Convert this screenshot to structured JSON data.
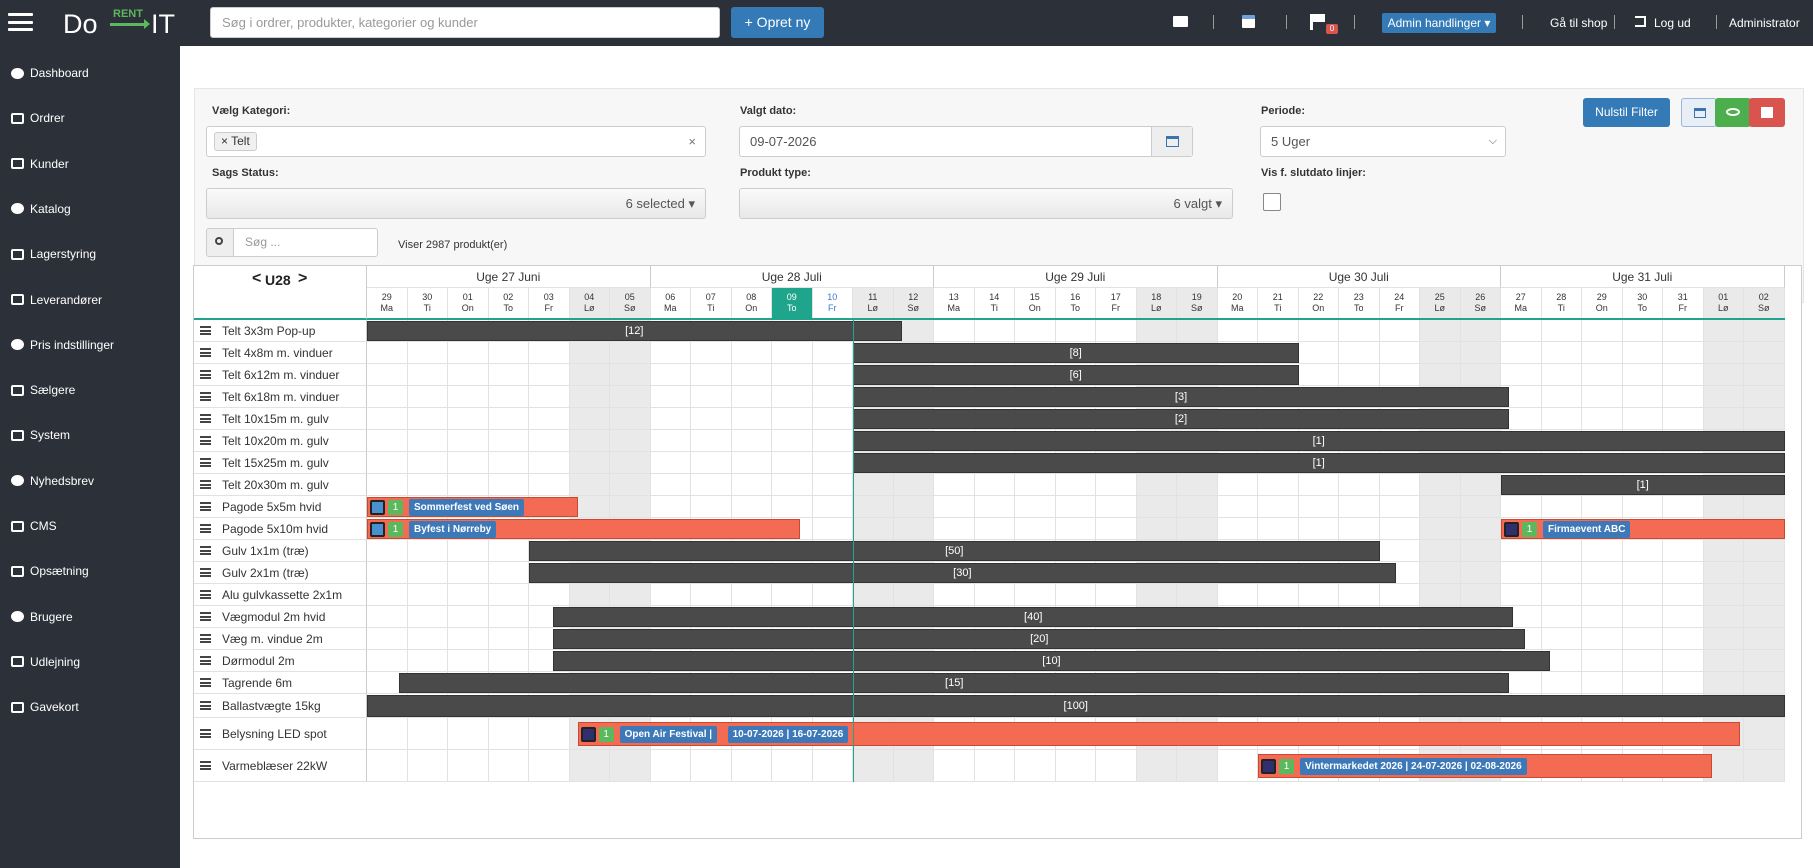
{
  "topbar": {
    "logo_left": "Do",
    "logo_middle": "RENT",
    "logo_right": "IT",
    "search_placeholder": "Søg i ordrer, produkter, kategorier og kunder",
    "new_button": "+ Opret ny",
    "flag_badge": "0",
    "admin_actions": "Admin handlinger ▾",
    "goto_shop": "Gå til shop",
    "logout": "Log ud",
    "user": "Administrator"
  },
  "sidebar": {
    "items": [
      {
        "label": "Dashboard",
        "icon": "dashboard-icon"
      },
      {
        "label": "Ordrer",
        "icon": "cart-icon"
      },
      {
        "label": "Kunder",
        "icon": "user-icon"
      },
      {
        "label": "Katalog",
        "icon": "folder-icon"
      },
      {
        "label": "Lagerstyring",
        "icon": "bar-chart-icon"
      },
      {
        "label": "Leverandører",
        "icon": "truck-icon"
      },
      {
        "label": "Pris indstillinger",
        "icon": "money-icon"
      },
      {
        "label": "Sælgere",
        "icon": "users-icon"
      },
      {
        "label": "System",
        "icon": "hdd-icon"
      },
      {
        "label": "Nyhedsbrev",
        "icon": "home-icon"
      },
      {
        "label": "CMS",
        "icon": "book-icon"
      },
      {
        "label": "Opsætning",
        "icon": "gear-icon"
      },
      {
        "label": "Brugere",
        "icon": "user-icon"
      },
      {
        "label": "Udlejning",
        "icon": "copy-icon"
      },
      {
        "label": "Gavekort",
        "icon": "gift-icon"
      }
    ]
  },
  "filters": {
    "category_label": "Vælg Kategori:",
    "category_tag": "× Telt",
    "category_clear": "×",
    "date_label": "Valgt dato:",
    "date_value": "09-07-2026",
    "period_label": "Periode:",
    "period_value": "5 Uger",
    "status_label": "Sags Status:",
    "status_value": "6 selected ▾",
    "product_type_label": "Produkt type:",
    "product_type_value": "6 valgt ▾",
    "end_lines_label": "Vis f. slutdato linjer:",
    "reset_button": "Nulstil Filter",
    "search_placeholder": "Søg ...",
    "showing": "Viser 2987 produkt(er)"
  },
  "gantt": {
    "current_week": "U28",
    "weeks": [
      "Uge 27 Juni",
      "Uge 28 Juli",
      "Uge 29 Juli",
      "Uge 30 Juli",
      "Uge 31 Juli"
    ],
    "days": [
      [
        "29",
        "Ma"
      ],
      [
        "30",
        "Ti"
      ],
      [
        "01",
        "On"
      ],
      [
        "02",
        "To"
      ],
      [
        "03",
        "Fr"
      ],
      [
        "04",
        "Lø"
      ],
      [
        "05",
        "Sø"
      ],
      [
        "06",
        "Ma"
      ],
      [
        "07",
        "Ti"
      ],
      [
        "08",
        "On"
      ],
      [
        "09",
        "To"
      ],
      [
        "10",
        "Fr"
      ],
      [
        "11",
        "Lø"
      ],
      [
        "12",
        "Sø"
      ],
      [
        "13",
        "Ma"
      ],
      [
        "14",
        "Ti"
      ],
      [
        "15",
        "On"
      ],
      [
        "16",
        "To"
      ],
      [
        "17",
        "Fr"
      ],
      [
        "18",
        "Lø"
      ],
      [
        "19",
        "Sø"
      ],
      [
        "20",
        "Ma"
      ],
      [
        "21",
        "Ti"
      ],
      [
        "22",
        "On"
      ],
      [
        "23",
        "To"
      ],
      [
        "24",
        "Fr"
      ],
      [
        "25",
        "Lø"
      ],
      [
        "26",
        "Sø"
      ],
      [
        "27",
        "Ma"
      ],
      [
        "28",
        "Ti"
      ],
      [
        "29",
        "On"
      ],
      [
        "30",
        "To"
      ],
      [
        "31",
        "Fr"
      ],
      [
        "01",
        "Lø"
      ],
      [
        "02",
        "Sø"
      ]
    ],
    "today_index": 10,
    "rows": [
      {
        "name": "Telt 3x3m Pop-up",
        "bars": [
          {
            "start": 0,
            "end": 13.2,
            "label": "[12]"
          }
        ]
      },
      {
        "name": "Telt 4x8m m. vinduer",
        "bars": [
          {
            "start": 12,
            "end": 23,
            "label": "[8]"
          }
        ]
      },
      {
        "name": "Telt 6x12m m. vinduer",
        "bars": [
          {
            "start": 12,
            "end": 23,
            "label": "[6]"
          }
        ]
      },
      {
        "name": "Telt 6x18m m. vinduer",
        "bars": [
          {
            "start": 12,
            "end": 28.2,
            "label": "[3]"
          }
        ]
      },
      {
        "name": "Telt 10x15m m. gulv",
        "bars": [
          {
            "start": 12,
            "end": 28.2,
            "label": "[2]"
          }
        ]
      },
      {
        "name": "Telt 10x20m m. gulv",
        "bars": [
          {
            "start": 12,
            "end": 35,
            "label": "[1]"
          }
        ]
      },
      {
        "name": "Telt 15x25m m. gulv",
        "bars": [
          {
            "start": 12,
            "end": 35,
            "label": "[1]"
          }
        ]
      },
      {
        "name": "Telt 20x30m m. gulv",
        "bars": [
          {
            "start": 28,
            "end": 35,
            "label": "[1]"
          }
        ]
      },
      {
        "name": "Pagode 5x5m hvid",
        "events": [
          {
            "start": 0,
            "end": 5.2,
            "count": "1",
            "label": "Sommerfest ved Søen",
            "box": "#4a8fd0"
          }
        ]
      },
      {
        "name": "Pagode 5x10m hvid",
        "events": [
          {
            "start": 0,
            "end": 10.7,
            "count": "1",
            "label": "Byfest i Nørreby",
            "box": "#4a8fd0"
          },
          {
            "start": 28,
            "end": 35,
            "count": "1",
            "label": "Firmaevent ABC",
            "box": "#2f2f6e"
          }
        ]
      },
      {
        "name": "Gulv 1x1m (træ)",
        "bars": [
          {
            "start": 4,
            "end": 25,
            "label": "[50]"
          }
        ]
      },
      {
        "name": "Gulv 2x1m (træ)",
        "bars": [
          {
            "start": 4,
            "end": 25.4,
            "label": "[30]"
          }
        ]
      },
      {
        "name": "Alu gulvkassette 2x1m",
        "bars": []
      },
      {
        "name": "Vægmodul 2m hvid",
        "bars": [
          {
            "start": 4.6,
            "end": 28.3,
            "label": "[40]"
          }
        ]
      },
      {
        "name": "Væg m. vindue 2m",
        "bars": [
          {
            "start": 4.6,
            "end": 28.6,
            "label": "[20]"
          }
        ]
      },
      {
        "name": "Dørmodul 2m",
        "bars": [
          {
            "start": 4.6,
            "end": 29.2,
            "label": "[10]"
          }
        ]
      },
      {
        "name": "Tagrende 6m",
        "bars": [
          {
            "start": 0.8,
            "end": 28.2,
            "label": "[15]"
          }
        ]
      },
      {
        "name": "Ballastvægte 15kg",
        "bars": [
          {
            "start": 0,
            "end": 35,
            "label": "[100]"
          }
        ]
      },
      {
        "name": "Belysning LED spot",
        "events": [
          {
            "start": 5.2,
            "end": 33.9,
            "count": "1",
            "label": "Open Air Festival |",
            "extra": "10-07-2026 | 16-07-2026",
            "box": "#2f2f6e"
          }
        ]
      },
      {
        "name": "Varmeblæser 22kW",
        "events": [
          {
            "start": 22,
            "end": 33.2,
            "count": "1",
            "label": "Vintermarkedet 2026 | 24-07-2026 | 02-08-2026",
            "box": "#2f2f6e"
          }
        ]
      }
    ]
  },
  "colors": {
    "dark_bg": "#2c3038",
    "primary": "#337ab7",
    "success": "#5cb85c",
    "danger": "#d9534f",
    "bar": "#4a4a4a",
    "event_bar": "#f36b52",
    "today": "#1fa58c"
  }
}
